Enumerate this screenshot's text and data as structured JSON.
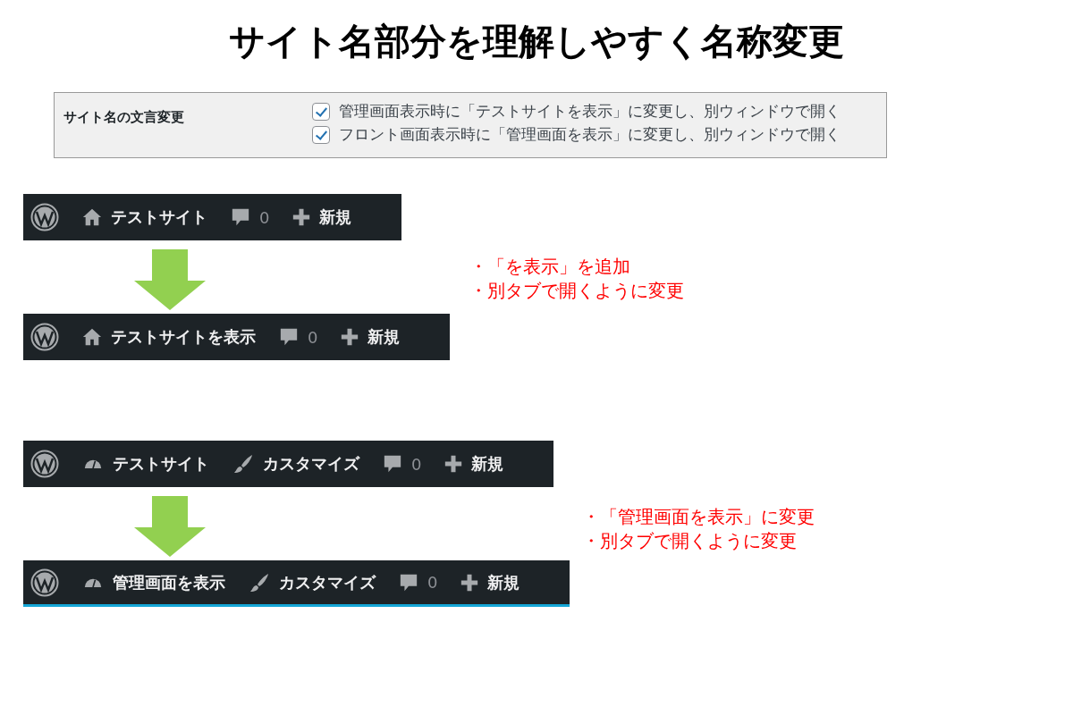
{
  "title": "サイト名部分を理解しやすく名称変更",
  "settings": {
    "label": "サイト名の文言変更",
    "options": [
      {
        "label": "管理画面表示時に「テストサイトを表示」に変更し、別ウィンドウで開く",
        "checked": true
      },
      {
        "label": "フロント画面表示時に「管理画面を表示」に変更し、別ウィンドウで開く",
        "checked": true
      }
    ]
  },
  "examples": [
    {
      "before": {
        "underlined": false,
        "items": [
          {
            "kind": "logo"
          },
          {
            "kind": "home",
            "label": "テストサイト"
          },
          {
            "kind": "comments",
            "label": "0"
          },
          {
            "kind": "new",
            "label": "新規"
          }
        ]
      },
      "after": {
        "underlined": false,
        "items": [
          {
            "kind": "logo"
          },
          {
            "kind": "home",
            "label": "テストサイトを表示"
          },
          {
            "kind": "comments",
            "label": "0"
          },
          {
            "kind": "new",
            "label": "新規"
          }
        ]
      },
      "notes": [
        "・「を表示」を追加",
        "・別タブで開くように変更"
      ]
    },
    {
      "before": {
        "underlined": false,
        "items": [
          {
            "kind": "logo"
          },
          {
            "kind": "dashboard",
            "label": "テストサイト"
          },
          {
            "kind": "customize",
            "label": "カスタマイズ"
          },
          {
            "kind": "comments",
            "label": "0"
          },
          {
            "kind": "new",
            "label": "新規"
          }
        ]
      },
      "after": {
        "underlined": true,
        "items": [
          {
            "kind": "logo"
          },
          {
            "kind": "dashboard",
            "label": "管理画面を表示"
          },
          {
            "kind": "customize",
            "label": "カスタマイズ"
          },
          {
            "kind": "comments",
            "label": "0"
          },
          {
            "kind": "new",
            "label": "新規"
          }
        ]
      },
      "notes": [
        "・「管理画面を表示」に変更",
        "・別タブで開くように変更"
      ]
    }
  ]
}
